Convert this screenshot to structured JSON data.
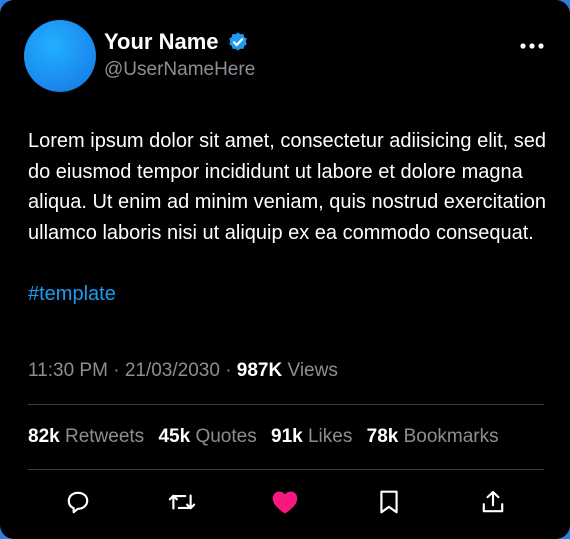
{
  "colors": {
    "accent": "#1d9bf0",
    "like": "#f91880",
    "text_muted": "#8b8f95",
    "background": "#000000"
  },
  "user": {
    "name": "Your Name",
    "handle": "@UserNameHere",
    "verified": true
  },
  "post": {
    "text": "Lorem ipsum dolor sit amet, consectetur adiisicing elit, sed do eiusmod tempor incididunt ut labore et dolore magna aliqua. Ut enim ad minim veniam, quis nostrud exercitation ullamco laboris nisi ut aliquip ex ea commodo consequat.",
    "hashtag": "#template",
    "time": "11:30 PM",
    "date": "21/03/2030",
    "views_count": "987K",
    "views_label": "Views"
  },
  "stats": [
    {
      "count": "82k",
      "label": "Retweets"
    },
    {
      "count": "45k",
      "label": "Quotes"
    },
    {
      "count": "91k",
      "label": "Likes"
    },
    {
      "count": "78k",
      "label": "Bookmarks"
    }
  ],
  "actions": [
    {
      "name": "reply",
      "icon": "comment-icon"
    },
    {
      "name": "retweet",
      "icon": "retweet-icon"
    },
    {
      "name": "like",
      "icon": "heart-icon",
      "active": true
    },
    {
      "name": "bookmark",
      "icon": "bookmark-icon"
    },
    {
      "name": "share",
      "icon": "share-icon"
    }
  ],
  "more_icon": "more-options-icon"
}
